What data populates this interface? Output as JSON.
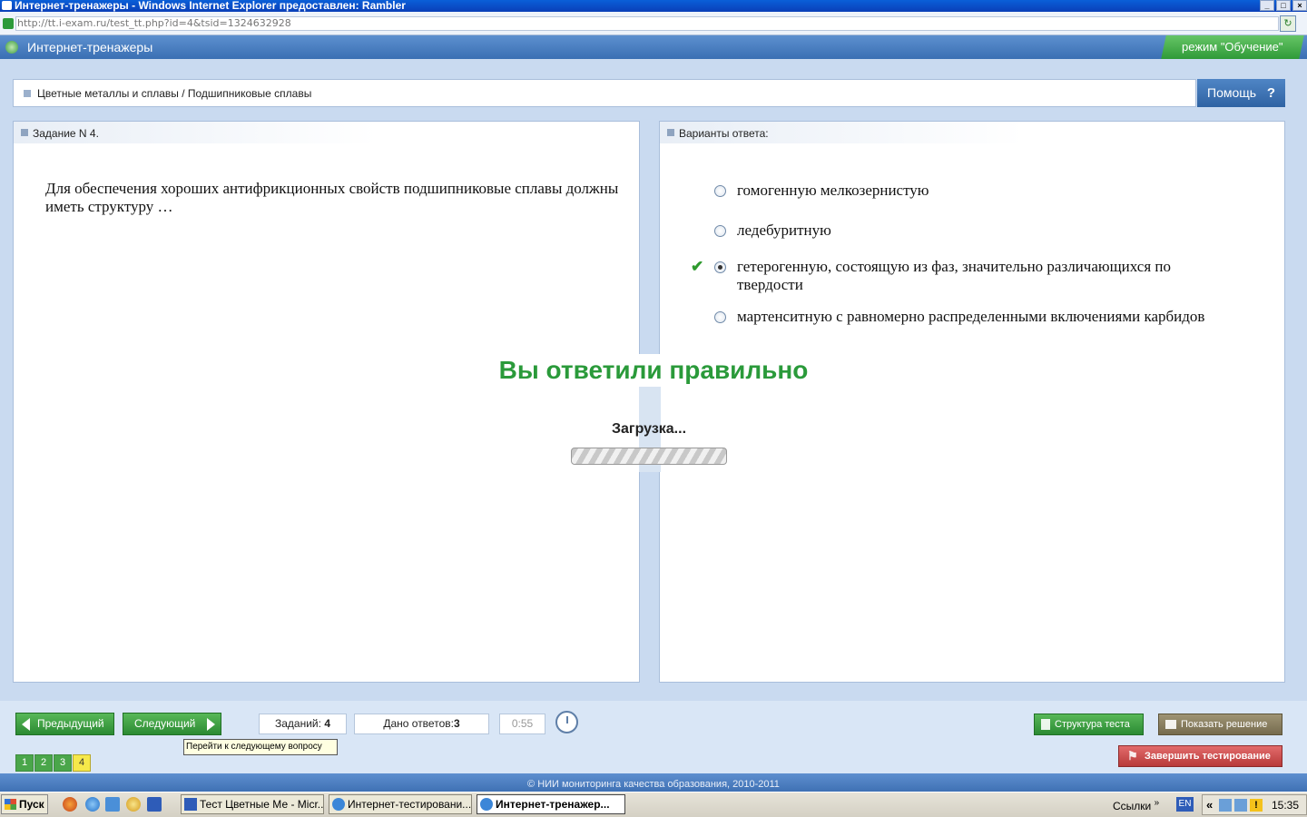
{
  "window": {
    "title": "Интернет-тренажеры - Windows Internet Explorer предоставлен: Rambler",
    "controls": {
      "minimize": "_",
      "maximize": "□",
      "close": "×"
    }
  },
  "browser": {
    "address": "http://tt.i-exam.ru/test_tt.php?id=4&tsid=1324632928"
  },
  "app": {
    "title": "Интернет-тренажеры",
    "mode": "режим \"Обучение\"",
    "breadcrumb": "Цветные металлы и сплавы / Подшипниковые сплавы",
    "help": "Помощь",
    "help_icon": "?"
  },
  "task_panel": {
    "header": "Задание N 4.",
    "question": "Для обеспечения хороших антифрикционных свойств подшипниковые сплавы должны иметь структуру …"
  },
  "answers_panel": {
    "header": "Варианты ответа:",
    "options": [
      {
        "text": "гомогенную мелкозернистую",
        "selected": false,
        "correct": false
      },
      {
        "text": "ледебуритную",
        "selected": false,
        "correct": false
      },
      {
        "text": "гетерогенную, состоящую из фаз, значительно различающихся по твердости",
        "selected": true,
        "correct": true
      },
      {
        "text": "мартенситную с равномерно распределенными включениями карбидов",
        "selected": false,
        "correct": false
      }
    ]
  },
  "overlay": {
    "result": "Вы ответили правильно",
    "loading": "Загрузка..."
  },
  "footer": {
    "prev": "Предыдущий",
    "next": "Следующий",
    "tasks_label": "Заданий:",
    "tasks_count": "4",
    "answers_label": "Дано ответов:",
    "answers_count": "3",
    "timer": "0:55",
    "tooltip": "Перейти к следующему вопросу",
    "pages": [
      "1",
      "2",
      "3",
      "4"
    ],
    "current_page": "4",
    "structure": "Структура теста",
    "show_solution": "Показать решение",
    "finish": "Завершить тестирование",
    "copyright": "© НИИ мониторинга качества образования, 2010-2011"
  },
  "taskbar": {
    "start": "Пуск",
    "tasks": [
      "Тест Цветные Ме - Micr...",
      "Интернет-тестировани...",
      "Интернет-тренажер..."
    ],
    "links": "Ссылки",
    "links_chevron": "»",
    "lang": "EN",
    "tray_chevron": "«",
    "tray_alert": "!",
    "clock": "15:35"
  },
  "colors": {
    "header_blue": "#3a6fb3",
    "mode_green": "#2f9a38",
    "correct_green": "#2a9a3a",
    "finish_red": "#b83a3a",
    "current_page_yellow": "#f6e84a"
  }
}
